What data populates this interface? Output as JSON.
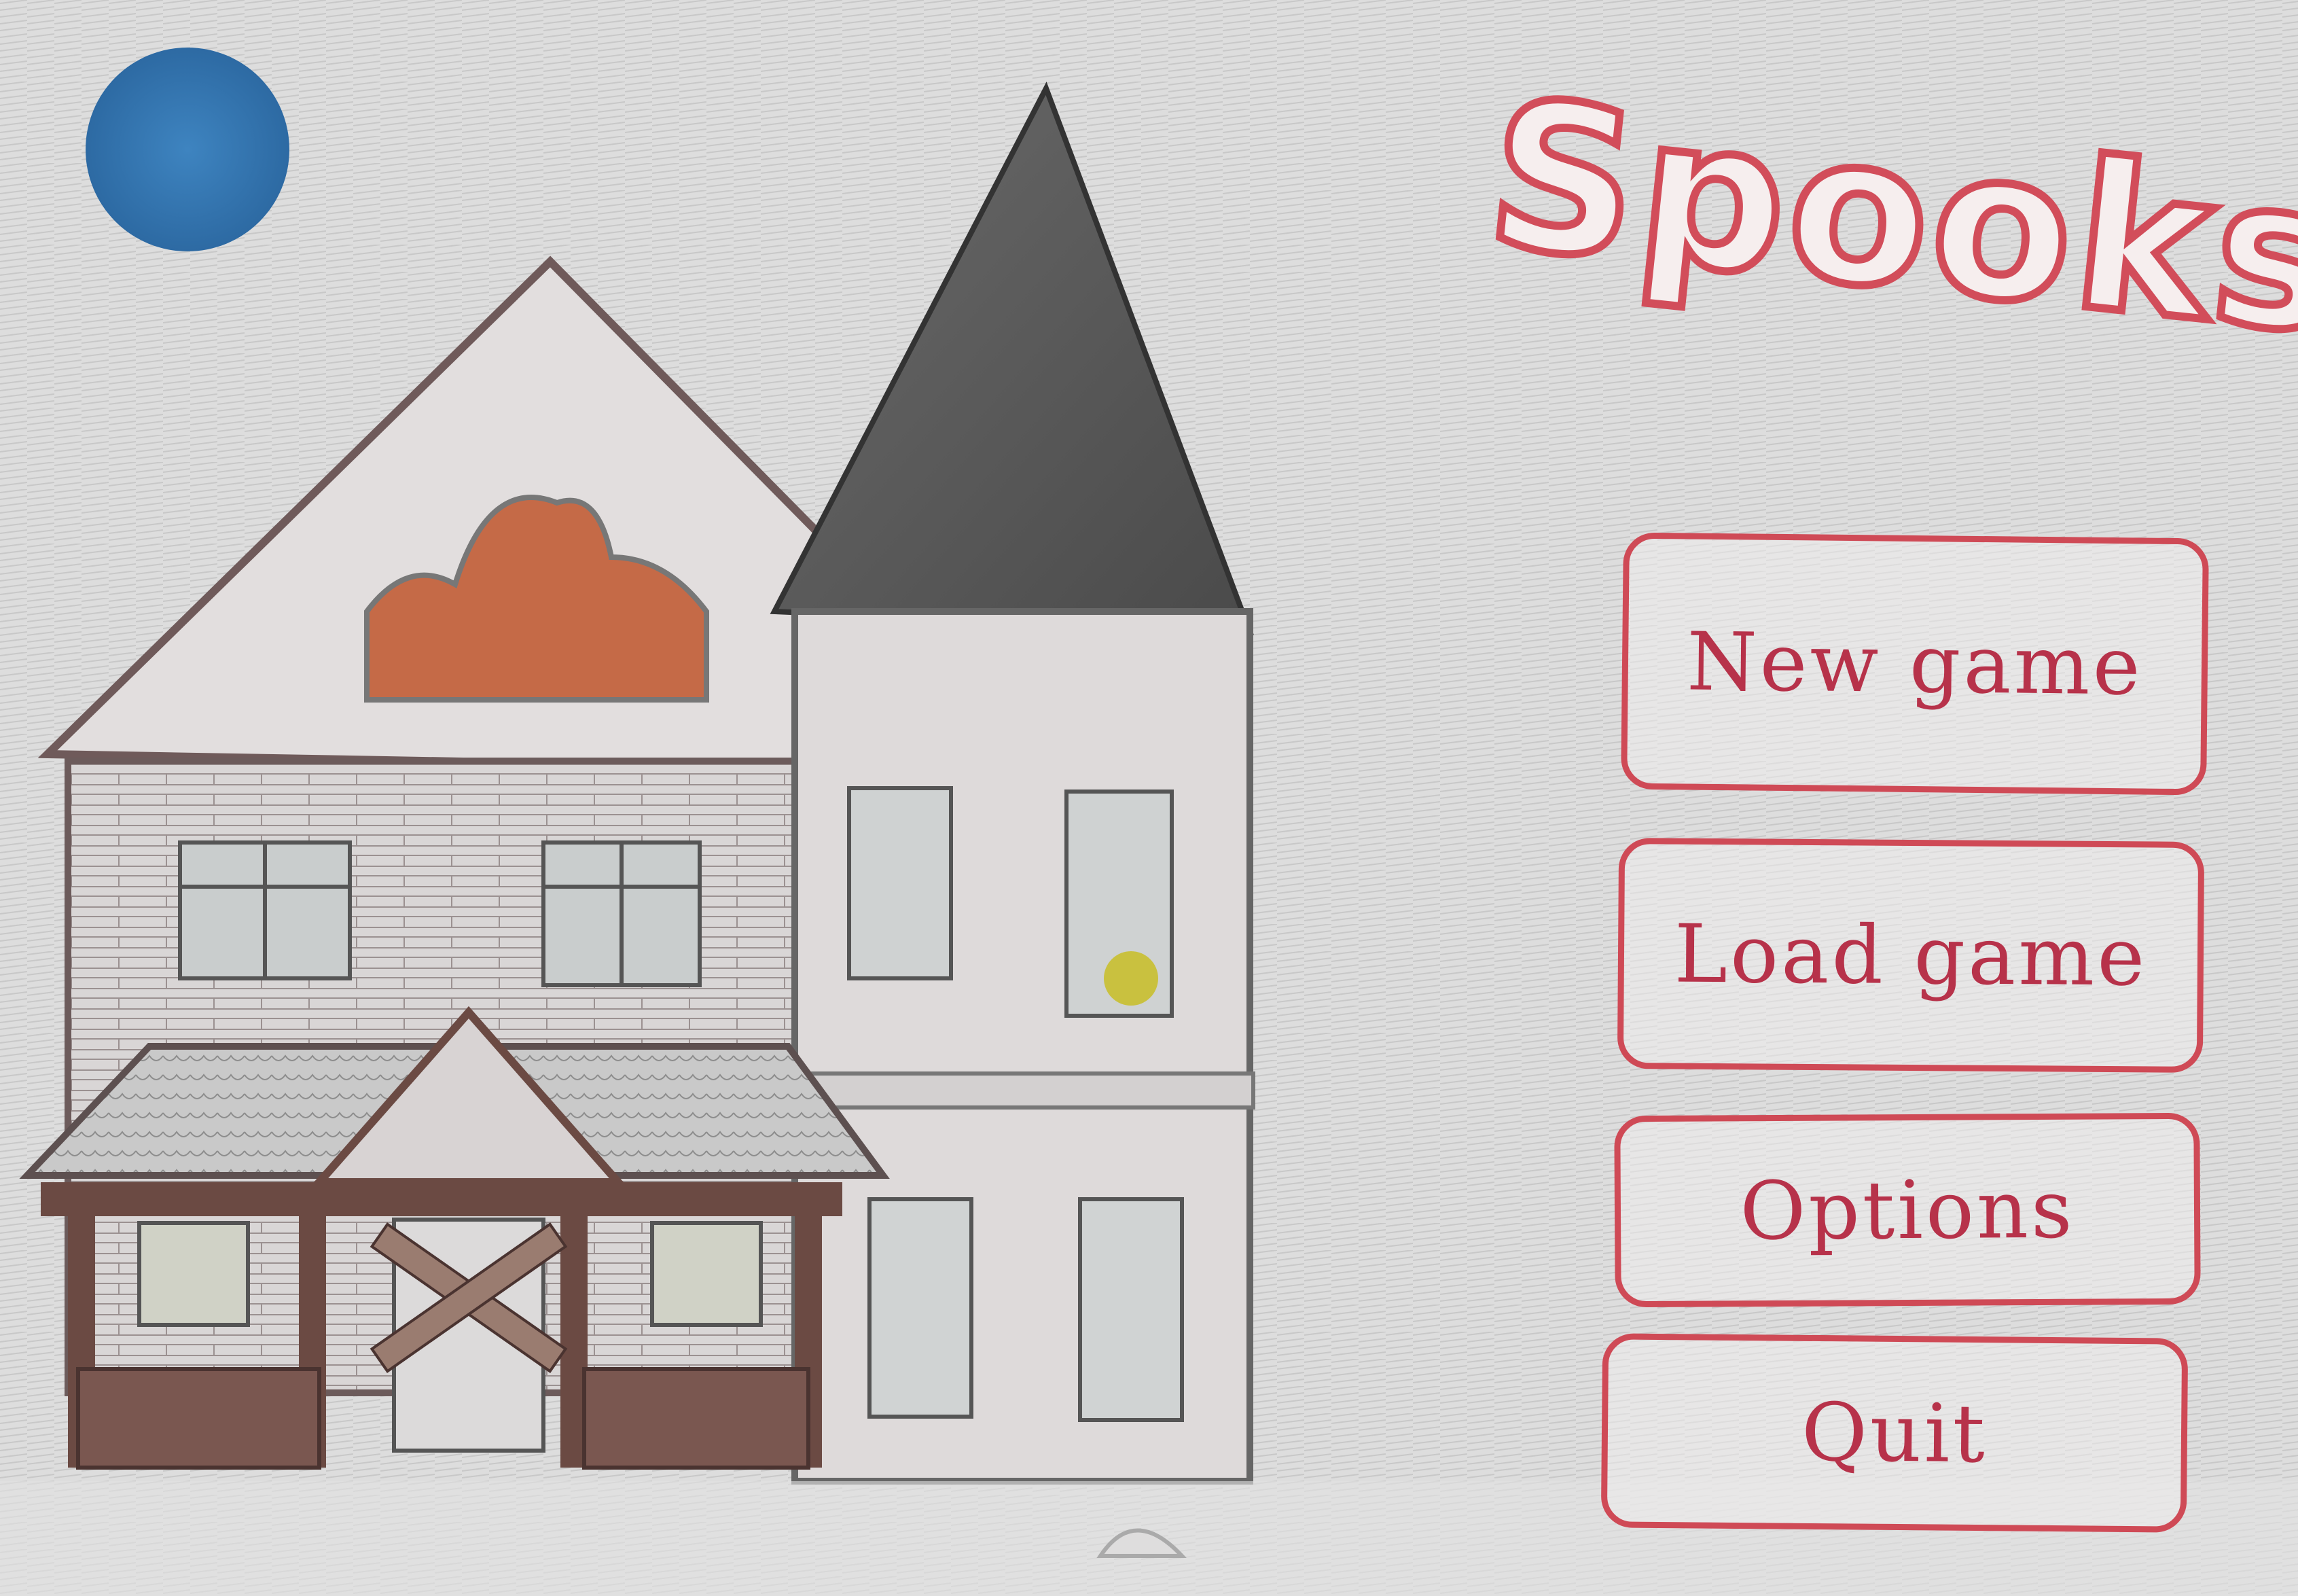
{
  "game": {
    "title": "Spooks"
  },
  "menu": {
    "new_game": "New game",
    "load_game": "Load game",
    "options": "Options",
    "quit": "Quit"
  },
  "colors": {
    "paper": "#e9e9e9",
    "pencil_gray": "#cfcfcf",
    "accent_red": "#cf4a56",
    "moon_blue": "#3a7db8",
    "tower_roof": "#5c5c5c",
    "attic_window_glow": "#c86a44",
    "porch_wood": "#6b4a43",
    "window_light_yellow": "#c9c13f"
  },
  "icons": {
    "moon": "moon-icon",
    "house": "haunted-house-illustration"
  }
}
